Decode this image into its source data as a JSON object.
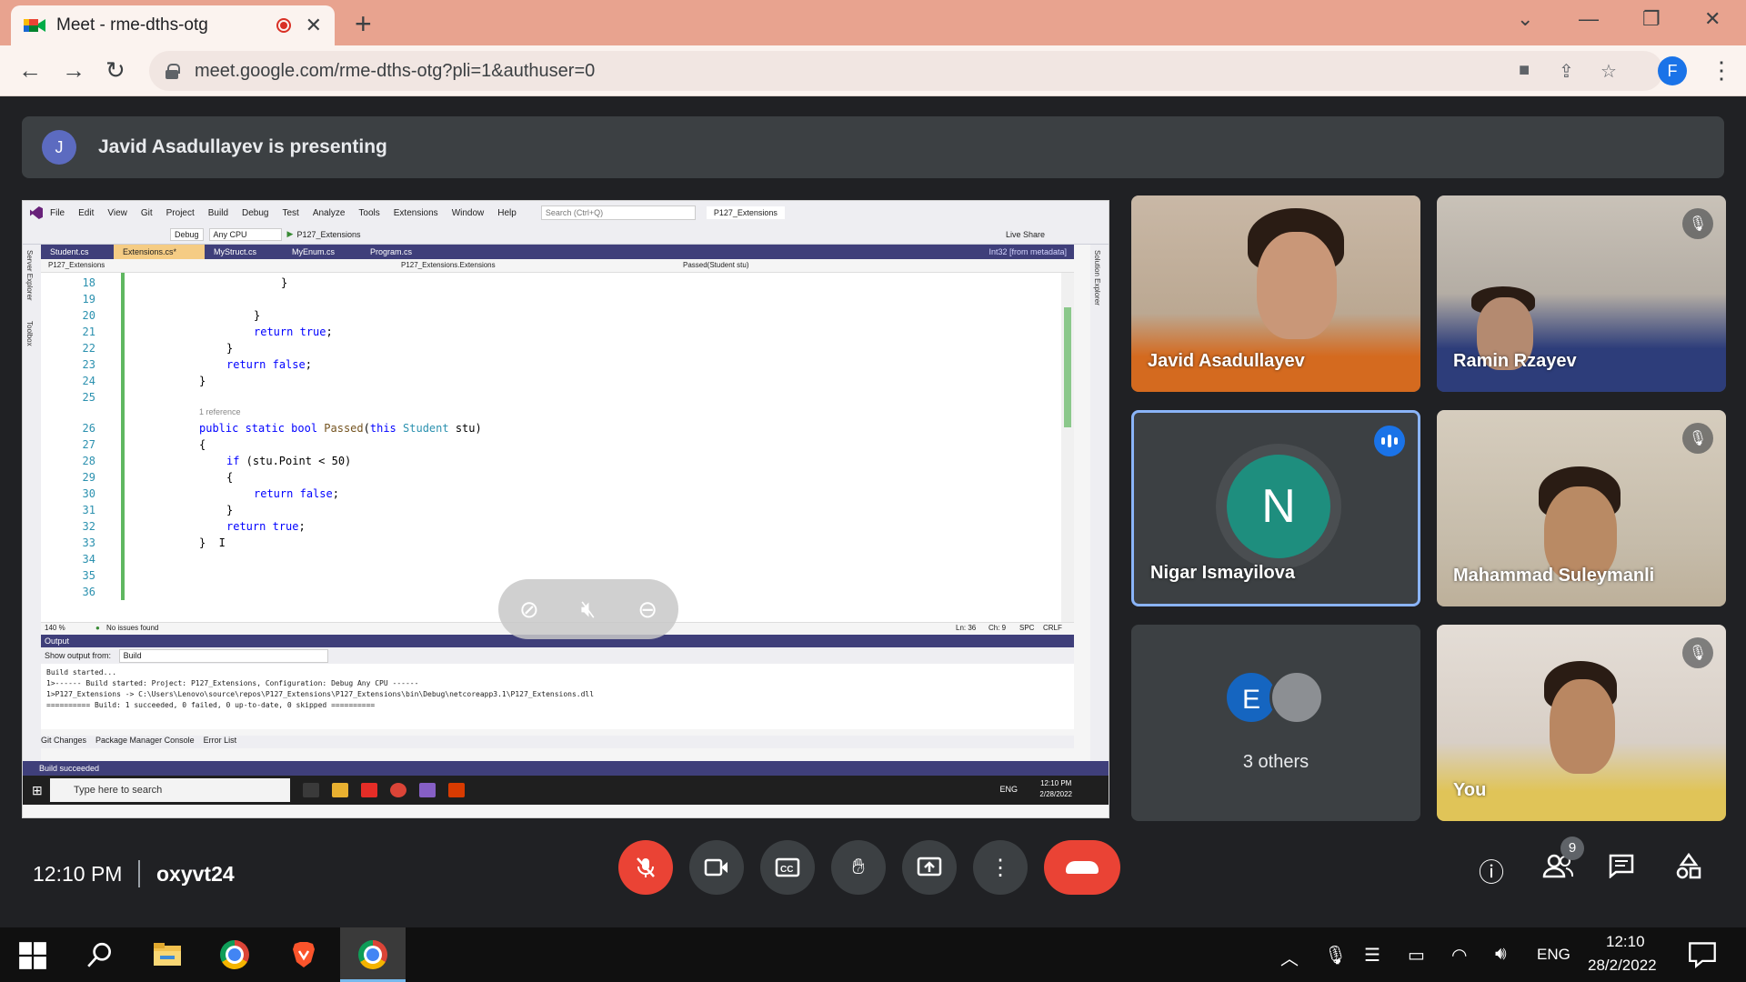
{
  "browser": {
    "tab_title": "Meet - rme-dths-otg",
    "url": "meet.google.com/rme-dths-otg?pli=1&authuser=0",
    "profile_initial": "F"
  },
  "meet": {
    "presenting": {
      "avatar_initial": "J",
      "text": "Javid Asadullayev is presenting"
    },
    "participants": [
      {
        "name": "Javid Asadullayev"
      },
      {
        "name": "Ramin Rzayev"
      },
      {
        "name": "Nigar Ismayilova",
        "initial": "N"
      },
      {
        "name": "Mahammad Suleymanli"
      },
      {
        "name": "3 others",
        "initial": "E"
      },
      {
        "name": "You"
      }
    ],
    "time": "12:10 PM",
    "meeting_code": "oxyvt24",
    "people_count": "9"
  },
  "vs": {
    "menu": [
      "File",
      "Edit",
      "View",
      "Git",
      "Project",
      "Build",
      "Debug",
      "Test",
      "Analyze",
      "Tools",
      "Extensions",
      "Window",
      "Help"
    ],
    "search_placeholder": "Search (Ctrl+Q)",
    "solution_title": "P127_Extensions",
    "config": "Debug",
    "platform": "Any CPU",
    "run_target": "P127_Extensions",
    "live_share": "Live Share",
    "tabs": [
      "Student.cs",
      "Extensions.cs*",
      "MyStruct.cs",
      "MyEnum.cs",
      "Program.cs"
    ],
    "tab_right": "Int32 [from metadata]",
    "nav_project": "P127_Extensions",
    "nav_class": "P127_Extensions.Extensions",
    "nav_member": "Passed(Student stu)",
    "codelens": "1 reference",
    "line_numbers": [
      "18",
      "19",
      "20",
      "21",
      "22",
      "23",
      "24",
      "25",
      "26",
      "27",
      "28",
      "29",
      "30",
      "31",
      "32",
      "33",
      "34",
      "35",
      "36"
    ],
    "zoom": "140 %",
    "issues": "No issues found",
    "ln_info": "Ln: 36",
    "ch_info": "Ch: 9",
    "spc": "SPC",
    "crlf": "CRLF",
    "output_title": "Output",
    "output_from_label": "Show output from:",
    "output_from_value": "Build",
    "output_lines": [
      "Build started...",
      "1>------ Build started: Project: P127_Extensions, Configuration: Debug Any CPU ------",
      "1>P127_Extensions -> C:\\Users\\Lenovo\\source\\repos\\P127_Extensions\\P127_Extensions\\bin\\Debug\\netcoreapp3.1\\P127_Extensions.dll",
      "========== Build: 1 succeeded, 0 failed, 0 up-to-date, 0 skipped =========="
    ],
    "bottom_tabs": [
      "Git Changes",
      "Package Manager Console",
      "Error List"
    ],
    "status": "Build succeeded",
    "left_strip": [
      "Server Explorer",
      "Toolbox"
    ],
    "right_strip": "Solution Explorer"
  },
  "inner_taskbar": {
    "search_placeholder": "Type here to search",
    "lang": "ENG",
    "time": "12:10 PM",
    "date": "2/28/2022"
  },
  "taskbar": {
    "lang": "ENG",
    "time": "12:10",
    "date": "28/2/2022"
  }
}
